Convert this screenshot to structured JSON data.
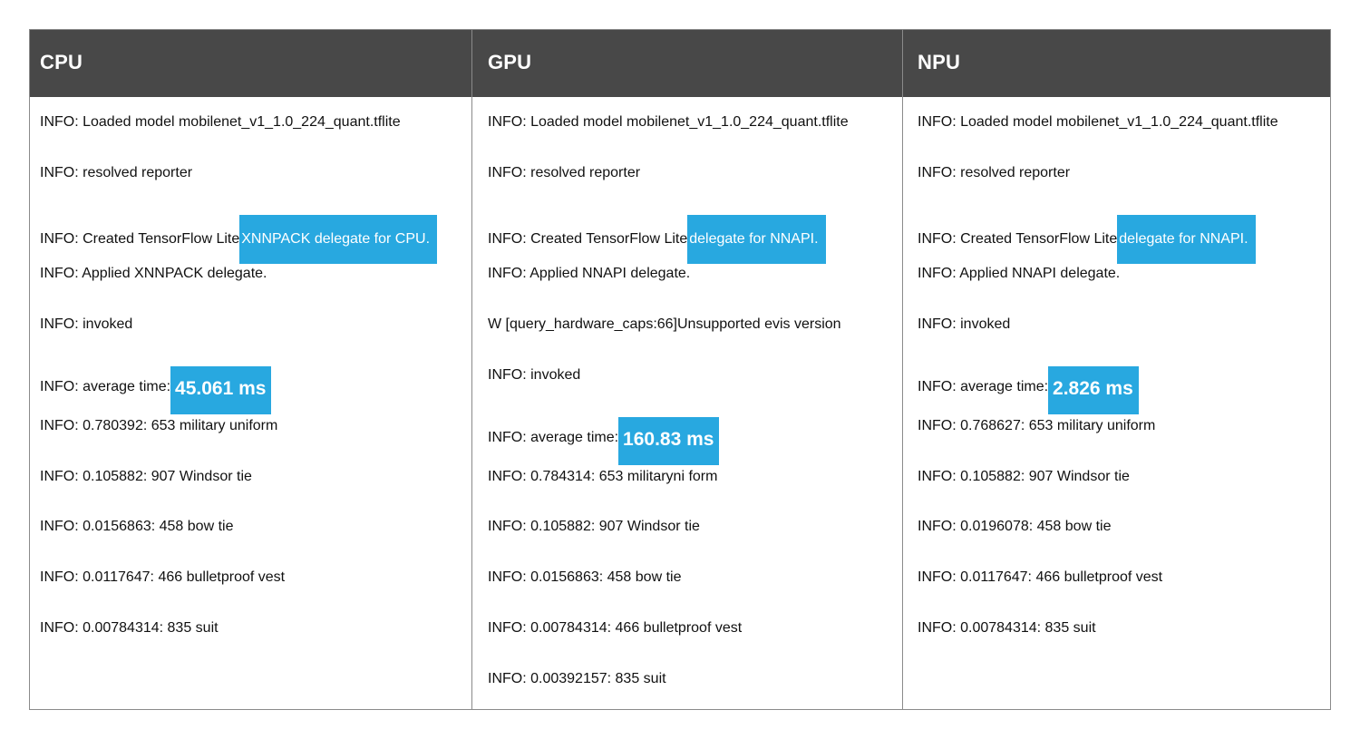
{
  "columns": [
    {
      "title": "CPU",
      "lines": [
        {
          "text": "INFO: Loaded model mobilenet_v1_1.0_224_quant.tflite"
        },
        {
          "text": "INFO: resolved reporter"
        },
        {
          "text": "INFO: Created TensorFlow Lite",
          "highlight": "XNNPACK delegate for CPU."
        },
        {
          "text": "INFO: Applied XNNPACK delegate."
        },
        {
          "text": "INFO: invoked"
        },
        {
          "text": "INFO: average time:",
          "time": "45.061 ms"
        },
        {
          "text": "INFO: 0.780392: 653 military uniform"
        },
        {
          "text": "INFO: 0.105882: 907 Windsor tie"
        },
        {
          "text": "INFO: 0.0156863: 458 bow tie"
        },
        {
          "text": "INFO: 0.0117647: 466 bulletproof vest"
        },
        {
          "text": "INFO: 0.00784314: 835 suit"
        }
      ]
    },
    {
      "title": "GPU",
      "lines": [
        {
          "text": "INFO: Loaded model mobilenet_v1_1.0_224_quant.tflite"
        },
        {
          "text": "INFO: resolved reporter"
        },
        {
          "text": "INFO: Created TensorFlow Lite",
          "highlight": "delegate for NNAPI."
        },
        {
          "text": "INFO: Applied NNAPI delegate."
        },
        {
          "text": "W [query_hardware_caps:66]Unsupported evis version"
        },
        {
          "text": "INFO: invoked"
        },
        {
          "text": "INFO: average time:",
          "time": "160.83 ms"
        },
        {
          "text": "INFO: 0.784314: 653 militaryni form"
        },
        {
          "text": "INFO: 0.105882: 907 Windsor tie"
        },
        {
          "text": "INFO: 0.0156863: 458 bow tie"
        },
        {
          "text": "INFO: 0.00784314: 466 bulletproof vest"
        },
        {
          "text": "INFO: 0.00392157: 835 suit"
        }
      ]
    },
    {
      "title": "NPU",
      "lines": [
        {
          "text": "INFO: Loaded model mobilenet_v1_1.0_224_quant.tflite"
        },
        {
          "text": "INFO: resolved reporter"
        },
        {
          "text": "INFO: Created TensorFlow Lite",
          "highlight": "delegate for NNAPI."
        },
        {
          "text": "INFO: Applied NNAPI delegate."
        },
        {
          "text": "INFO: invoked"
        },
        {
          "text": "INFO: average time:",
          "time": "2.826 ms"
        },
        {
          "text": "INFO: 0.768627: 653 military uniform"
        },
        {
          "text": "INFO: 0.105882: 907 Windsor tie"
        },
        {
          "text": "INFO: 0.0196078: 458 bow tie"
        },
        {
          "text": "INFO: 0.0117647: 466 bulletproof vest"
        },
        {
          "text": "INFO: 0.00784314: 835 suit"
        }
      ]
    }
  ],
  "colors": {
    "header_bg": "#484848",
    "highlight": "#28a8e0",
    "border": "#8a8a8a"
  }
}
